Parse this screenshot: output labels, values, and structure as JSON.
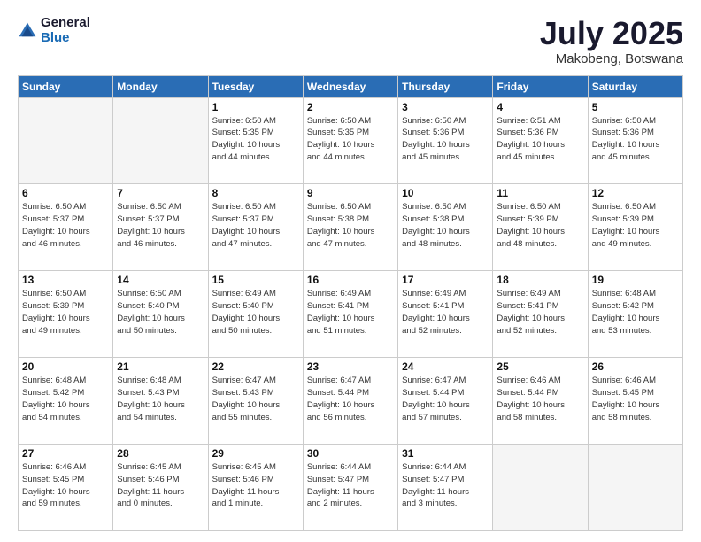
{
  "logo": {
    "general": "General",
    "blue": "Blue"
  },
  "title": "July 2025",
  "location": "Makobeng, Botswana",
  "weekdays": [
    "Sunday",
    "Monday",
    "Tuesday",
    "Wednesday",
    "Thursday",
    "Friday",
    "Saturday"
  ],
  "weeks": [
    [
      {
        "day": "",
        "info": ""
      },
      {
        "day": "",
        "info": ""
      },
      {
        "day": "1",
        "info": "Sunrise: 6:50 AM\nSunset: 5:35 PM\nDaylight: 10 hours\nand 44 minutes."
      },
      {
        "day": "2",
        "info": "Sunrise: 6:50 AM\nSunset: 5:35 PM\nDaylight: 10 hours\nand 44 minutes."
      },
      {
        "day": "3",
        "info": "Sunrise: 6:50 AM\nSunset: 5:36 PM\nDaylight: 10 hours\nand 45 minutes."
      },
      {
        "day": "4",
        "info": "Sunrise: 6:51 AM\nSunset: 5:36 PM\nDaylight: 10 hours\nand 45 minutes."
      },
      {
        "day": "5",
        "info": "Sunrise: 6:50 AM\nSunset: 5:36 PM\nDaylight: 10 hours\nand 45 minutes."
      }
    ],
    [
      {
        "day": "6",
        "info": "Sunrise: 6:50 AM\nSunset: 5:37 PM\nDaylight: 10 hours\nand 46 minutes."
      },
      {
        "day": "7",
        "info": "Sunrise: 6:50 AM\nSunset: 5:37 PM\nDaylight: 10 hours\nand 46 minutes."
      },
      {
        "day": "8",
        "info": "Sunrise: 6:50 AM\nSunset: 5:37 PM\nDaylight: 10 hours\nand 47 minutes."
      },
      {
        "day": "9",
        "info": "Sunrise: 6:50 AM\nSunset: 5:38 PM\nDaylight: 10 hours\nand 47 minutes."
      },
      {
        "day": "10",
        "info": "Sunrise: 6:50 AM\nSunset: 5:38 PM\nDaylight: 10 hours\nand 48 minutes."
      },
      {
        "day": "11",
        "info": "Sunrise: 6:50 AM\nSunset: 5:39 PM\nDaylight: 10 hours\nand 48 minutes."
      },
      {
        "day": "12",
        "info": "Sunrise: 6:50 AM\nSunset: 5:39 PM\nDaylight: 10 hours\nand 49 minutes."
      }
    ],
    [
      {
        "day": "13",
        "info": "Sunrise: 6:50 AM\nSunset: 5:39 PM\nDaylight: 10 hours\nand 49 minutes."
      },
      {
        "day": "14",
        "info": "Sunrise: 6:50 AM\nSunset: 5:40 PM\nDaylight: 10 hours\nand 50 minutes."
      },
      {
        "day": "15",
        "info": "Sunrise: 6:49 AM\nSunset: 5:40 PM\nDaylight: 10 hours\nand 50 minutes."
      },
      {
        "day": "16",
        "info": "Sunrise: 6:49 AM\nSunset: 5:41 PM\nDaylight: 10 hours\nand 51 minutes."
      },
      {
        "day": "17",
        "info": "Sunrise: 6:49 AM\nSunset: 5:41 PM\nDaylight: 10 hours\nand 52 minutes."
      },
      {
        "day": "18",
        "info": "Sunrise: 6:49 AM\nSunset: 5:41 PM\nDaylight: 10 hours\nand 52 minutes."
      },
      {
        "day": "19",
        "info": "Sunrise: 6:48 AM\nSunset: 5:42 PM\nDaylight: 10 hours\nand 53 minutes."
      }
    ],
    [
      {
        "day": "20",
        "info": "Sunrise: 6:48 AM\nSunset: 5:42 PM\nDaylight: 10 hours\nand 54 minutes."
      },
      {
        "day": "21",
        "info": "Sunrise: 6:48 AM\nSunset: 5:43 PM\nDaylight: 10 hours\nand 54 minutes."
      },
      {
        "day": "22",
        "info": "Sunrise: 6:47 AM\nSunset: 5:43 PM\nDaylight: 10 hours\nand 55 minutes."
      },
      {
        "day": "23",
        "info": "Sunrise: 6:47 AM\nSunset: 5:44 PM\nDaylight: 10 hours\nand 56 minutes."
      },
      {
        "day": "24",
        "info": "Sunrise: 6:47 AM\nSunset: 5:44 PM\nDaylight: 10 hours\nand 57 minutes."
      },
      {
        "day": "25",
        "info": "Sunrise: 6:46 AM\nSunset: 5:44 PM\nDaylight: 10 hours\nand 58 minutes."
      },
      {
        "day": "26",
        "info": "Sunrise: 6:46 AM\nSunset: 5:45 PM\nDaylight: 10 hours\nand 58 minutes."
      }
    ],
    [
      {
        "day": "27",
        "info": "Sunrise: 6:46 AM\nSunset: 5:45 PM\nDaylight: 10 hours\nand 59 minutes."
      },
      {
        "day": "28",
        "info": "Sunrise: 6:45 AM\nSunset: 5:46 PM\nDaylight: 11 hours\nand 0 minutes."
      },
      {
        "day": "29",
        "info": "Sunrise: 6:45 AM\nSunset: 5:46 PM\nDaylight: 11 hours\nand 1 minute."
      },
      {
        "day": "30",
        "info": "Sunrise: 6:44 AM\nSunset: 5:47 PM\nDaylight: 11 hours\nand 2 minutes."
      },
      {
        "day": "31",
        "info": "Sunrise: 6:44 AM\nSunset: 5:47 PM\nDaylight: 11 hours\nand 3 minutes."
      },
      {
        "day": "",
        "info": ""
      },
      {
        "day": "",
        "info": ""
      }
    ]
  ]
}
